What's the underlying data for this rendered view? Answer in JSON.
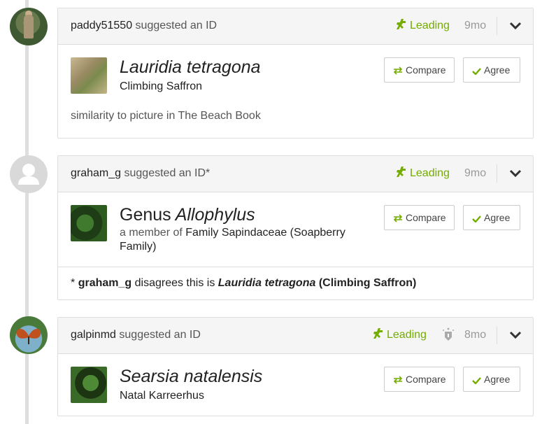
{
  "colors": {
    "leading": "#74ac00",
    "muted": "#999999",
    "border": "#dddddd"
  },
  "identifications": [
    {
      "user": "paddy51550",
      "action": "suggested an ID",
      "status": "Leading",
      "age": "9mo",
      "taxon_name": "Lauridia tetragona",
      "common_name": "Climbing Saffron",
      "remark": "similarity to picture in The Beach Book",
      "compare_label": "Compare",
      "agree_label": "Agree"
    },
    {
      "user": "graham_g",
      "action": "suggested an ID*",
      "status": "Leading",
      "age": "9mo",
      "rank": "Genus",
      "taxon_name": "Allophylus",
      "member_prefix": "a member of",
      "member_of": "Family Sapindaceae (Soapberry Family)",
      "footer_star": "*",
      "footer_user": "graham_g",
      "footer_text": "disagrees this is",
      "footer_taxon": "Lauridia tetragona",
      "footer_common": "(Climbing Saffron)",
      "compare_label": "Compare",
      "agree_label": "Agree"
    },
    {
      "user": "galpinmd",
      "action": "suggested an ID",
      "status": "Leading",
      "age": "8mo",
      "taxon_name": "Searsia natalensis",
      "common_name": "Natal Karreerhus",
      "compare_label": "Compare",
      "agree_label": "Agree"
    }
  ]
}
